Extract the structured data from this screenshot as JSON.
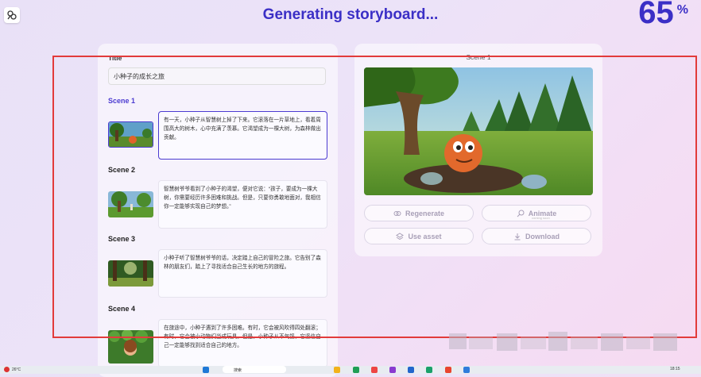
{
  "header": {
    "title": "Generating storyboard...",
    "progress_value": "65",
    "progress_symbol": "%"
  },
  "left_panel": {
    "title_label": "Title",
    "title_value": "小种子的成长之旅",
    "scenes": [
      {
        "label": "Scene 1",
        "text": "有一天，小种子从智慧树上掉了下来。它滚落在一片草地上，看着周围高大的树木，心中充满了羡慕。它渴望成为一棵大树，为森林做出贡献。"
      },
      {
        "label": "Scene 2",
        "text": "智慧树爷爷看到了小种子的渴望，便对它说：“孩子，要成为一棵大树，你需要经历许多困难和挑战。但是，只要你勇敢地面对，我相信你一定能够实现自己的梦想。”"
      },
      {
        "label": "Scene 3",
        "text": "小种子听了智慧树爷爷的话，决定踏上自己的冒险之旅。它告别了森林的朋友们，踏上了寻找适合自己生长的地方的旅程。"
      },
      {
        "label": "Scene 4",
        "text": "在旅途中，小种子遇到了许多困难。有时，它会被风吹得四处翻滚；有时，它会被小动物们当成玩具。但是，小种子从不气馁，它坚信自己一定能够找到适合自己的地方。"
      }
    ]
  },
  "right_panel": {
    "scene_label": "Scene 1",
    "buttons": {
      "regenerate": "Regenerate",
      "animate": "Animate",
      "animate_sub": "coming soon",
      "use_asset": "Use asset",
      "download": "Download"
    }
  },
  "taskbar": {
    "weather": "26°C",
    "search": "搜索",
    "time": "18:15"
  },
  "colors": {
    "accent": "#3b2fc6",
    "active_scene": "#4b3bd1",
    "annotation_box": "#e23b3b"
  }
}
